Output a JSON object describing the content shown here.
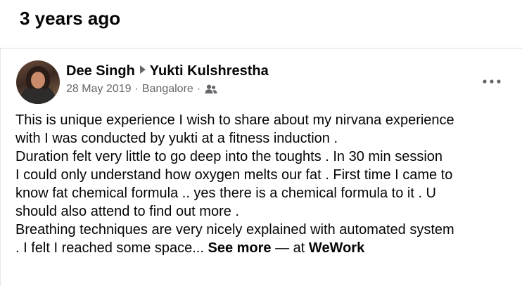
{
  "section": {
    "title": "3 years ago"
  },
  "post": {
    "author": "Dee Singh",
    "recipient": "Yukti Kulshrestha",
    "date": "28 May 2019",
    "location": "Bangalore",
    "separator": "·",
    "audience_icon": "friends-icon",
    "more_icon": "more-options-icon",
    "body_lines": [
      "This is unique experience I wish to share about my nirvana experience",
      "with I was conducted by yukti at a fitness induction .",
      "Duration felt very little to go deep into the toughts . In 30 min session",
      "I could only understand how oxygen melts our fat . First time I came to",
      "know fat chemical formula .. yes there is a chemical formula to it . U",
      "should also attend to find out more .",
      "Breathing techniques are very nicely explained with automated system"
    ],
    "last_line": ". I felt I reached some space...",
    "see_more": "See more",
    "at_text": "— at",
    "place": "WeWork"
  }
}
